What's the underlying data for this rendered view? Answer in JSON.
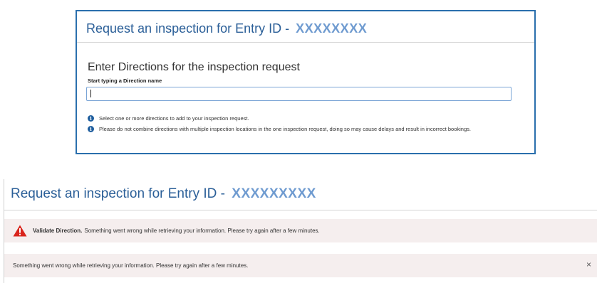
{
  "panel_top": {
    "title_prefix": "Request an inspection for Entry ID -",
    "entry_id": "XXXXXXXX",
    "section_heading": "Enter Directions for the inspection request",
    "field_label": "Start typing a Direction name",
    "input_value": "",
    "info_messages": [
      "Select one or more directions to add to your inspection request.",
      "Please do not combine directions with multiple inspection locations in the one inspection request, doing so may cause delays and result in incorrect bookings."
    ]
  },
  "panel_bottom": {
    "title_prefix": "Request an inspection for Entry ID -",
    "entry_id": "XXXXXXXXX",
    "warning_alert": {
      "bold_label": "Validate Direction.",
      "message": "Something went wrong while retrieving your information. Please try again after a few minutes."
    },
    "error_alert": {
      "message": "Something went wrong while retrieving your information. Please try again after a few minutes.",
      "close_label": "×"
    }
  },
  "colors": {
    "title_blue": "#2b5f98",
    "entry_id_blue": "#6f9bd0",
    "panel_border": "#2a6fad",
    "info_icon": "#1f5e9e",
    "warning_red": "#d9251d",
    "alert_bg": "#f5eeee"
  },
  "icons": {
    "info": "info-circle-icon",
    "warning": "warning-triangle-icon",
    "close": "close-icon"
  }
}
